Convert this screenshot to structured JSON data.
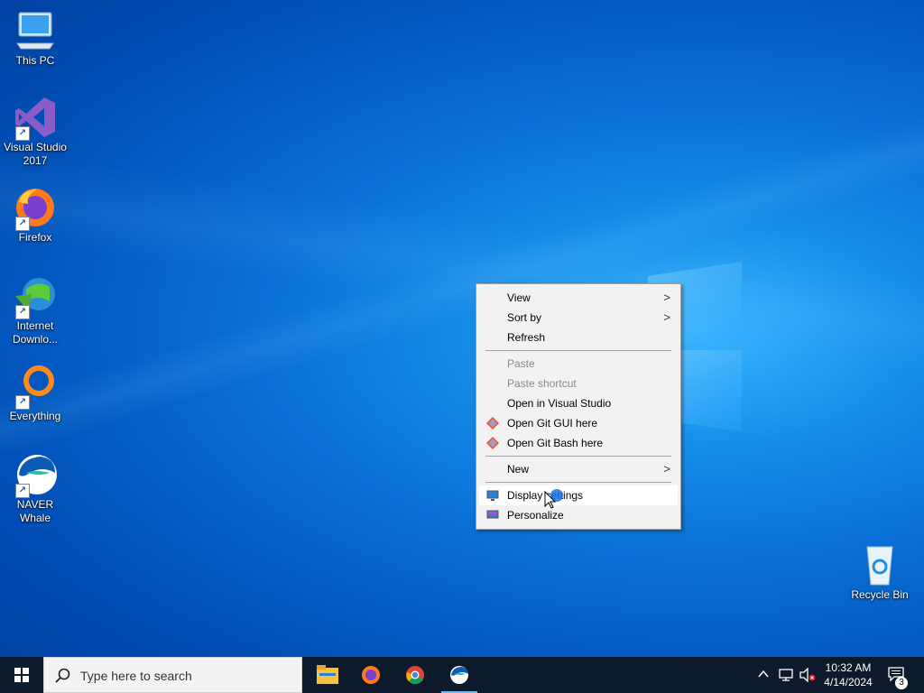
{
  "desktop": {
    "icons": [
      {
        "label": "This PC"
      },
      {
        "label": "Visual Studio 2017"
      },
      {
        "label": "Firefox"
      },
      {
        "label": "Internet Downlo..."
      },
      {
        "label": "Everything"
      },
      {
        "label": "NAVER Whale"
      },
      {
        "label": "Recycle Bin"
      }
    ]
  },
  "context_menu": {
    "items": [
      {
        "label": "View",
        "submenu": true
      },
      {
        "label": "Sort by",
        "submenu": true
      },
      {
        "label": "Refresh"
      },
      {
        "label": "Paste",
        "disabled": true
      },
      {
        "label": "Paste shortcut",
        "disabled": true
      },
      {
        "label": "Open in Visual Studio"
      },
      {
        "label": "Open Git GUI here",
        "icon": "git-icon"
      },
      {
        "label": "Open Git Bash here",
        "icon": "git-icon"
      },
      {
        "label": "New",
        "submenu": true
      },
      {
        "label": "Display settings",
        "icon": "display-settings-icon",
        "highlighted": true
      },
      {
        "label": "Personalize",
        "icon": "personalize-icon"
      }
    ]
  },
  "taskbar": {
    "search_placeholder": "Type here to search",
    "pinned": [
      "file-explorer-icon",
      "firefox-icon",
      "chrome-icon",
      "naver-whale-icon"
    ],
    "clock": {
      "time": "10:32 AM",
      "date": "4/14/2024"
    },
    "notification_count": "3"
  },
  "colors": {
    "taskbar": "#0c1a2b",
    "menu_bg": "#f2f2f2",
    "accent": "#0078d7"
  }
}
